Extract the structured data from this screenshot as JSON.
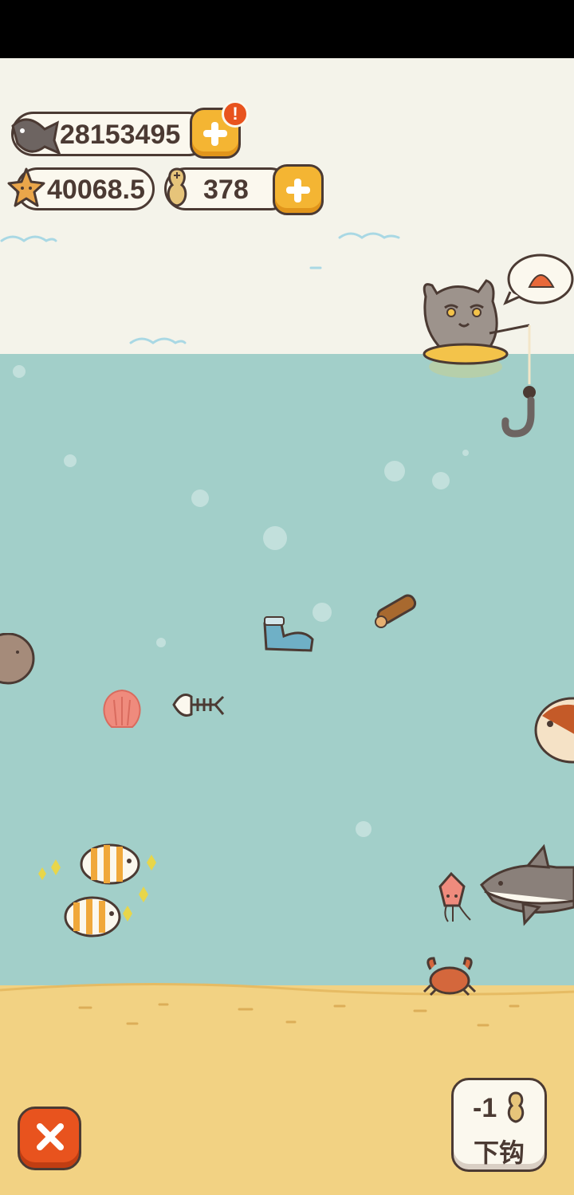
{
  "hud": {
    "fish_currency": "28153495",
    "star_currency": "40068.5",
    "bait_currency": "378",
    "notification_badge": "!"
  },
  "cast_button": {
    "cost": "-1",
    "label": "下钩"
  },
  "colors": {
    "sky": "#f4f3ea",
    "sea": "#a2cfc9",
    "sand": "#f2d283",
    "accent_yellow": "#f4b533",
    "close_red": "#e8531e",
    "outline": "#4b3a33"
  }
}
